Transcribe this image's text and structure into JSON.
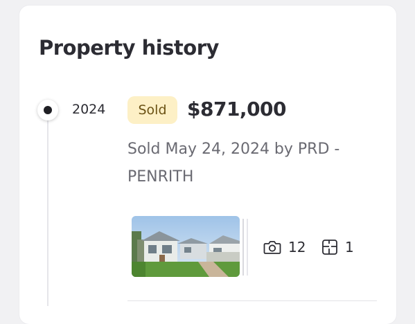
{
  "section": {
    "title": "Property history"
  },
  "history": [
    {
      "year": "2024",
      "badge": "Sold",
      "price": "$871,000",
      "detail": "Sold May 24, 2024 by PRD - PENRITH",
      "media": {
        "photos_icon": "camera-icon",
        "photos_count": "12",
        "floorplans_icon": "floorplan-icon",
        "floorplans_count": "1"
      }
    }
  ],
  "colors": {
    "badge_background": "#fdf0c6",
    "badge_text": "#6b5214",
    "heading_text": "#2c2c33",
    "detail_text": "#6a6a72"
  }
}
